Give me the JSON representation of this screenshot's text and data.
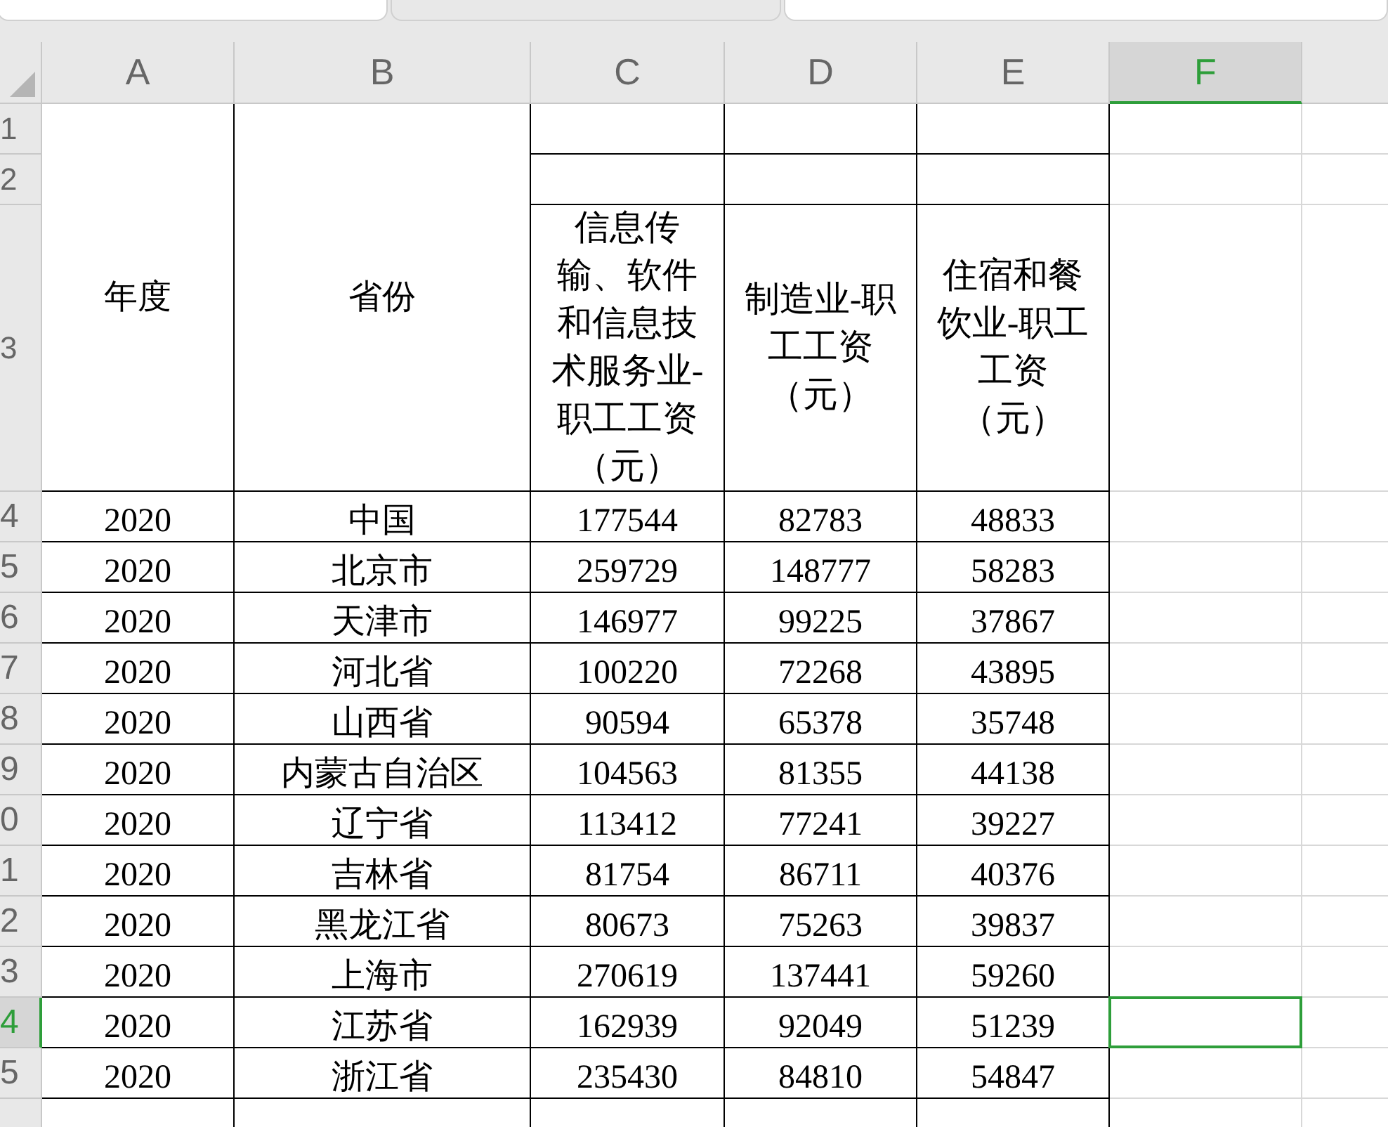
{
  "tabs": [
    {
      "selected": false
    },
    {
      "selected": true
    },
    {
      "selected": false
    }
  ],
  "columns": [
    {
      "label": "A",
      "selected": false
    },
    {
      "label": "B",
      "selected": false
    },
    {
      "label": "C",
      "selected": false
    },
    {
      "label": "D",
      "selected": false
    },
    {
      "label": "E",
      "selected": false
    },
    {
      "label": "F",
      "selected": true
    }
  ],
  "header_rows": [
    {
      "label": "1",
      "selected": false
    },
    {
      "label": "2",
      "selected": false
    },
    {
      "label": "3",
      "selected": false
    }
  ],
  "header": {
    "year": "年度",
    "province": "省份",
    "metrics": [
      "信息传输、软件和信息技术服务业-职工工资（元）",
      "制造业-职工工资（元）",
      "住宿和餐饮业-职工工资（元）"
    ]
  },
  "rows": [
    {
      "label": "4",
      "selected": false,
      "cells": [
        "2020",
        "中国",
        "177544",
        "82783",
        "48833"
      ]
    },
    {
      "label": "5",
      "selected": false,
      "cells": [
        "2020",
        "北京市",
        "259729",
        "148777",
        "58283"
      ]
    },
    {
      "label": "6",
      "selected": false,
      "cells": [
        "2020",
        "天津市",
        "146977",
        "99225",
        "37867"
      ]
    },
    {
      "label": "7",
      "selected": false,
      "cells": [
        "2020",
        "河北省",
        "100220",
        "72268",
        "43895"
      ]
    },
    {
      "label": "8",
      "selected": false,
      "cells": [
        "2020",
        "山西省",
        "90594",
        "65378",
        "35748"
      ]
    },
    {
      "label": "9",
      "selected": false,
      "cells": [
        "2020",
        "内蒙古自治区",
        "104563",
        "81355",
        "44138"
      ]
    },
    {
      "label": "0",
      "selected": false,
      "cells": [
        "2020",
        "辽宁省",
        "113412",
        "77241",
        "39227"
      ]
    },
    {
      "label": "1",
      "selected": false,
      "cells": [
        "2020",
        "吉林省",
        "81754",
        "86711",
        "40376"
      ]
    },
    {
      "label": "2",
      "selected": false,
      "cells": [
        "2020",
        "黑龙江省",
        "80673",
        "75263",
        "39837"
      ]
    },
    {
      "label": "3",
      "selected": false,
      "cells": [
        "2020",
        "上海市",
        "270619",
        "137441",
        "59260"
      ]
    },
    {
      "label": "4",
      "selected": true,
      "cells": [
        "2020",
        "江苏省",
        "162939",
        "92049",
        "51239"
      ]
    },
    {
      "label": "5",
      "selected": false,
      "cells": [
        "2020",
        "浙江省",
        "235430",
        "84810",
        "54847"
      ]
    }
  ]
}
